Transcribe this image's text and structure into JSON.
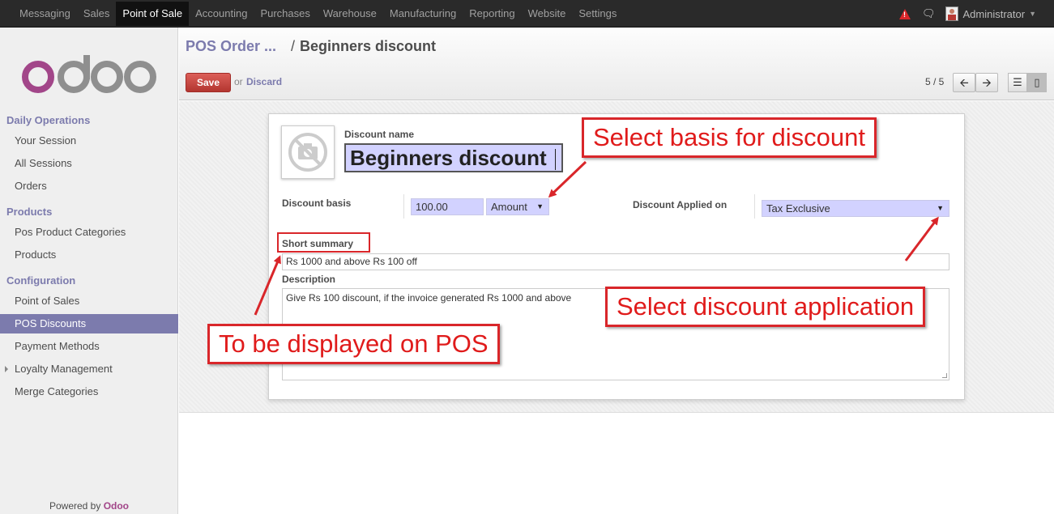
{
  "topbar": {
    "menu": [
      "Messaging",
      "Sales",
      "Point of Sale",
      "Accounting",
      "Purchases",
      "Warehouse",
      "Manufacturing",
      "Reporting",
      "Website",
      "Settings"
    ],
    "active_index": 2,
    "user": "Administrator"
  },
  "sidebar": {
    "sections": [
      {
        "title": "Daily Operations",
        "items": [
          "Your Session",
          "All Sessions",
          "Orders"
        ]
      },
      {
        "title": "Products",
        "items": [
          "Pos Product Categories",
          "Products"
        ]
      },
      {
        "title": "Configuration",
        "items": [
          "Point of Sales",
          "POS Discounts",
          "Payment Methods",
          "Loyalty Management",
          "Merge Categories"
        ]
      }
    ],
    "active_item": "POS Discounts",
    "powered_prefix": "Powered by",
    "powered_brand": "Odoo",
    "logo_text": "odoo"
  },
  "control": {
    "breadcrumb_parent": "POS Order ...",
    "breadcrumb_sep": "/",
    "breadcrumb_current": "Beginners discount",
    "save_label": "Save",
    "or_label": "or",
    "discard_label": "Discard",
    "pager": "5 / 5"
  },
  "form": {
    "discount_name_label": "Discount name",
    "discount_name_value": "Beginners discount",
    "discount_basis_label": "Discount basis",
    "discount_basis_value": "100.00",
    "discount_basis_type": "Amount",
    "applied_on_label": "Discount Applied on",
    "applied_on_value": "Tax Exclusive",
    "short_summary_label": "Short summary",
    "short_summary_value": "Rs 1000 and above Rs 100 off",
    "description_label": "Description",
    "description_value": "Give Rs 100 discount, if the invoice generated Rs 1000 and above"
  },
  "annotations": {
    "basis": "Select basis for discount",
    "application": "Select discount application",
    "pos": "To be displayed on POS"
  },
  "colors": {
    "accent": "#7c7bad",
    "save": "#c3312d",
    "annotation": "#d9262a",
    "input_bg": "#d2d2ff"
  }
}
